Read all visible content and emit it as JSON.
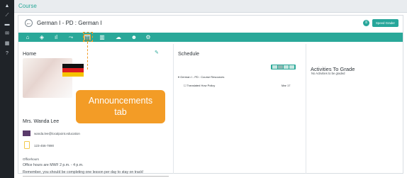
{
  "app": {
    "breadcrumb": "Course"
  },
  "header": {
    "title": "German I - PD : German I",
    "speed_grader_label": "Speed Grader"
  },
  "tabs": [
    {
      "name": "home",
      "icon": "home-icon",
      "active": false
    },
    {
      "name": "modules",
      "icon": "cube-icon",
      "active": false
    },
    {
      "name": "grades",
      "icon": "bar-chart-icon",
      "active": false
    },
    {
      "name": "analytics",
      "icon": "trend-icon",
      "active": false
    },
    {
      "name": "announcements",
      "icon": "announcement-icon",
      "active": true
    },
    {
      "name": "library",
      "icon": "library-icon",
      "active": false
    },
    {
      "name": "cloud",
      "icon": "cloud-icon",
      "active": false
    },
    {
      "name": "people",
      "icon": "people-icon",
      "active": false
    },
    {
      "name": "settings",
      "icon": "gear-icon",
      "active": false
    }
  ],
  "home": {
    "heading": "Home",
    "teacher_name": "Mrs. Wanda Lee",
    "email": "wanda.lee@localpoint.education",
    "phone": "123-456-7890",
    "office_label": "Officehours",
    "office_hours": "Office hours are MWF 2 p.m. - 4 p.m.",
    "reminder": "Remember, you should be completing one lesson per day to stay on track!"
  },
  "schedule": {
    "heading": "Schedule",
    "module": "German I - PD : Course Resources",
    "items": [
      {
        "label": "Translated How Policy",
        "due": "Mar 17"
      }
    ]
  },
  "grade": {
    "heading": "Activities To Grade",
    "empty": "No Activities to be graded"
  },
  "callout": {
    "line1": "Announcements",
    "line2": "tab"
  },
  "colors": {
    "accent": "#2aa899",
    "callout": "#f39c26",
    "sidebar": "#1f2328"
  }
}
